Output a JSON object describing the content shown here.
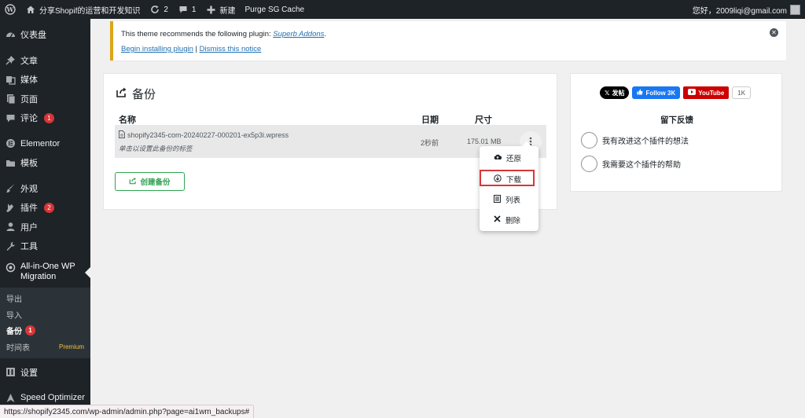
{
  "adminbar": {
    "site_name": "分享Shopif的运营和开发知识",
    "updates_count": "2",
    "comments_count": "1",
    "new_label": "新建",
    "purge_label": "Purge SG Cache",
    "greeting": "您好，2009liqi@gmail.com"
  },
  "sidebar": {
    "dashboard": "仪表盘",
    "posts": "文章",
    "media": "媒体",
    "pages": "页面",
    "comments": "评论",
    "comments_badge": "1",
    "elementor": "Elementor",
    "templates": "模板",
    "appearance": "外观",
    "plugins": "插件",
    "plugins_badge": "2",
    "users": "用户",
    "tools": "工具",
    "aiwm_line1": "All-in-One WP",
    "aiwm_line2": "Migration",
    "sub_export": "导出",
    "sub_import": "导入",
    "sub_backups": "备份",
    "sub_backups_badge": "1",
    "sub_schedules": "时间表",
    "sub_premium": "Premium",
    "settings": "设置",
    "speed_optimizer": "Speed Optimizer"
  },
  "notice": {
    "text_prefix": "This theme recommends the following plugin: ",
    "plugin_link": "Superb Addons",
    "text_suffix": ".",
    "install_link": "Begin installing plugin",
    "separator": " | ",
    "dismiss_link": "Dismiss this notice"
  },
  "backups": {
    "title": "备份",
    "col_name": "名称",
    "col_date": "日期",
    "col_size": "尺寸",
    "rows": [
      {
        "filename": "shopify2345-com-20240227-000201-ex5p3i.wpress",
        "label_hint": "单击以设置此备份的标签",
        "date": "2秒前",
        "size": "175.01 MB"
      }
    ],
    "create_label": "创建备份"
  },
  "dropdown": {
    "restore": "还原",
    "download": "下载",
    "list": "列表",
    "delete": "删除"
  },
  "right": {
    "x_post": "发帖",
    "fb_follow": "Follow 3K",
    "youtube": "YouTube",
    "yt_count": "1K",
    "feedback_title": "留下反馈",
    "option1": "我有改进这个插件的想法",
    "option2": "我需要这个插件的帮助"
  },
  "statusbar": {
    "url": "https://shopify2345.com/wp-admin/admin.php?page=ai1wm_backups#"
  }
}
